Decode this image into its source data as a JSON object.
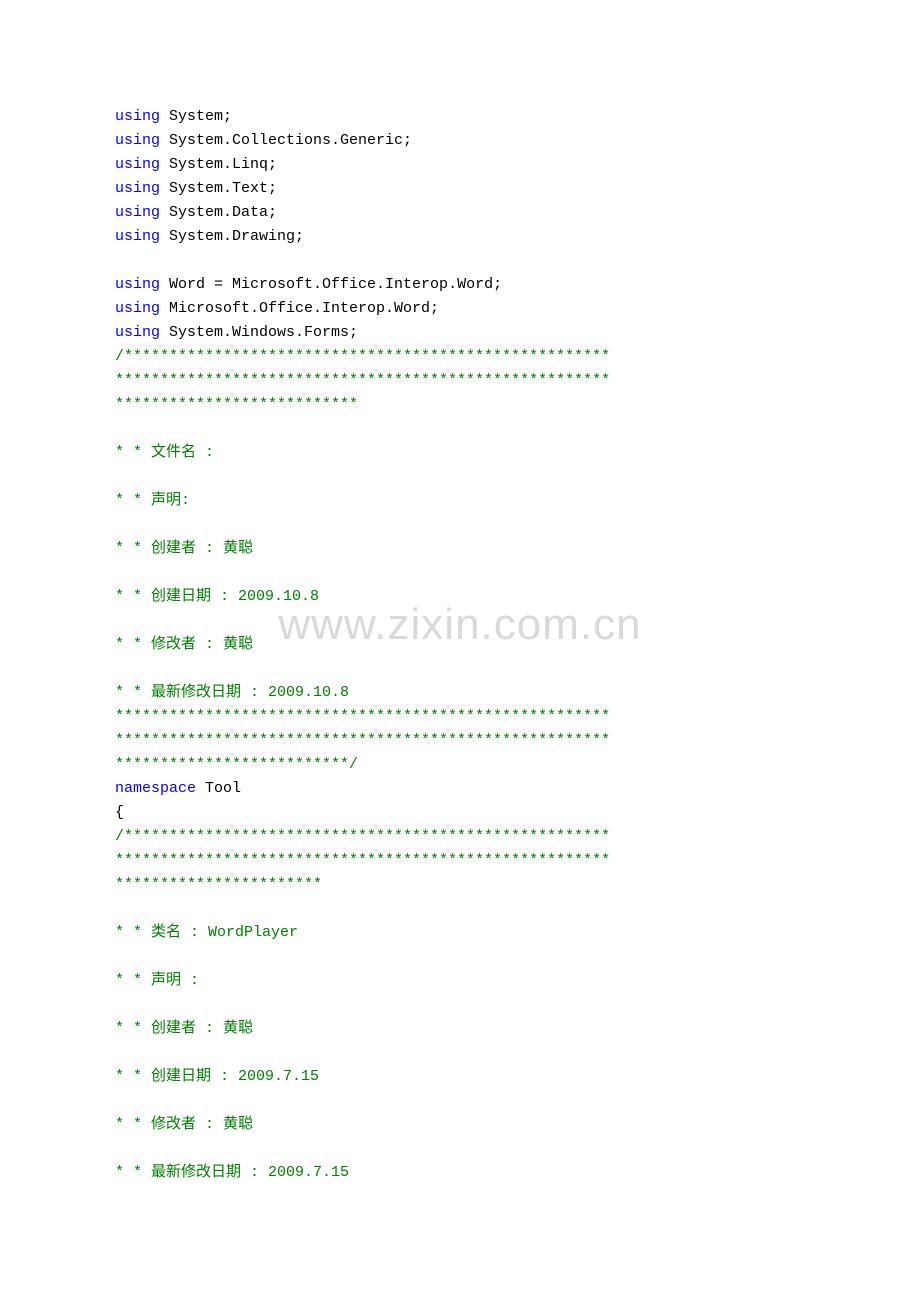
{
  "watermark": "www.zixin.com.cn",
  "code": {
    "kw_using": "using",
    "kw_namespace": "namespace",
    "u1": " System;",
    "u2": " System.Collections.Generic;",
    "u3": " System.Linq;",
    "u4": " System.Text;",
    "u5": " System.Data;",
    "u6": " System.Drawing;",
    "u7": " Word = Microsoft.Office.Interop.Word;",
    "u8": " Microsoft.Office.Interop.Word;",
    "u9": " System.Windows.Forms;",
    "ns": " Tool",
    "brace": "{",
    "hdr1_line1": "/******************************************************",
    "hdr1_line2": "*******************************************************",
    "hdr1_line3": "***************************",
    "hdr2_line1": "*******************************************************",
    "hdr2_line2": "*******************************************************",
    "hdr2_line3": "**************************/",
    "hdr3_line1": "/******************************************************",
    "hdr3_line2": "*******************************************************",
    "hdr3_line3": "***********************",
    "c_filename": "* * 文件名 :",
    "c_decl1": "* * 声明:",
    "c_author1": "* * 创建者 : 黄聪",
    "c_created1": "* * 创建日期 : 2009.10.8",
    "c_mod1": "* * 修改者 : 黄聪",
    "c_last1": "* * 最新修改日期 : 2009.10.8",
    "c_class": "* * 类名 : WordPlayer",
    "c_decl2": "* * 声明 :",
    "c_author2": "* * 创建者 : 黄聪",
    "c_created2": "* * 创建日期 : 2009.7.15",
    "c_mod2": "* * 修改者 : 黄聪",
    "c_last2": "* * 最新修改日期 : 2009.7.15"
  }
}
